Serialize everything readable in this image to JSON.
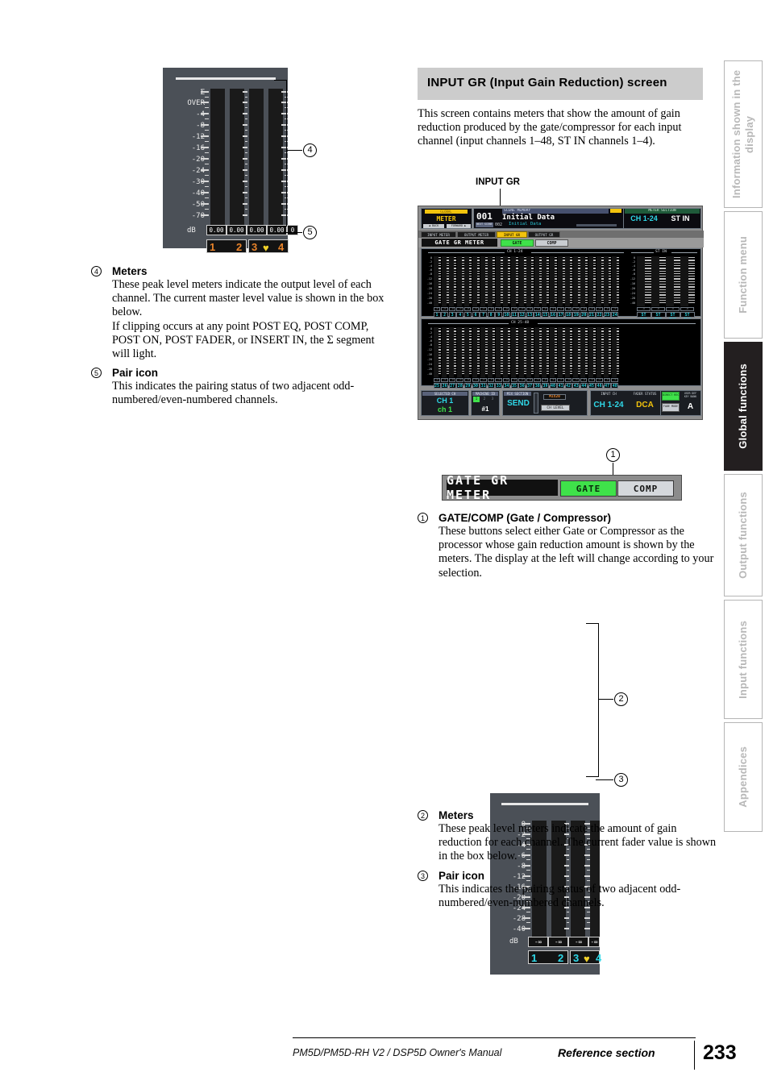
{
  "page": {
    "number": "233",
    "manual": "PM5D/PM5D-RH V2 / DSP5D Owner's Manual",
    "section": "Reference section"
  },
  "sidebar": {
    "tabs": [
      {
        "label": "Information shown in the display",
        "active": false
      },
      {
        "label": "Function menu",
        "active": false
      },
      {
        "label": "Global functions",
        "active": true
      },
      {
        "label": "Output functions",
        "active": false
      },
      {
        "label": "Input functions",
        "active": false
      },
      {
        "label": "Appendices",
        "active": false
      }
    ]
  },
  "left_column": {
    "figure": {
      "scale_labels": [
        "Σ",
        "OVER",
        "-4",
        "-8",
        "-12",
        "-16",
        "-20",
        "-24",
        "-30",
        "-40",
        "-50",
        "-70"
      ],
      "unit_label": "dB",
      "values": [
        "0.00",
        "0.00",
        "0.00",
        "0.00",
        "0"
      ],
      "pair_numbers": [
        "1",
        "2",
        "3",
        "4"
      ],
      "pair_heart": "♥",
      "callouts": [
        "4",
        "5"
      ]
    },
    "items": [
      {
        "number": "4",
        "title": "Meters",
        "paragraphs": [
          "These peak level meters indicate the output level of each channel. The current master level value is shown in the box below.",
          "If clipping occurs at any point POST EQ, POST COMP, POST ON, POST FADER, or INSERT IN, the Σ segment will light."
        ]
      },
      {
        "number": "5",
        "title": "Pair icon",
        "paragraphs": [
          "This indicates the pairing status of two adjacent odd-numbered/even-numbered channels."
        ]
      }
    ]
  },
  "right_column": {
    "heading": "INPUT GR (Input Gain Reduction) screen",
    "intro": "This screen contains meters that show the amount of gain reduction produced by the gate/compressor for each input channel (input channels 1–48, ST IN channels 1–4).",
    "screenshot_callout": "INPUT GR",
    "lcd": {
      "global_label": "GLOBAL",
      "menu_title": "METER",
      "nav_back": "◀ BACK",
      "nav_forward": "FORWARD ▶",
      "scene_memory_label": "SCENE MEMORY",
      "scene_number": "001",
      "scene_name": "Initial Data",
      "next_scene_label": "NEXT SCENE",
      "next_scene_number": "002",
      "next_scene_name": "Initial Data",
      "cascade_label": "CASCADE",
      "cascade_value": "SLAVE",
      "fs_label": "Fs",
      "fs_value": "48k",
      "meter_section_label": "METER SECTION",
      "meter_section_values": [
        "CH 1-24",
        "ST IN"
      ],
      "tabs": [
        {
          "label": "INPUT METER",
          "active": false
        },
        {
          "label": "OUTPUT METER",
          "active": false
        },
        {
          "label": "INPUT GR",
          "active": true
        },
        {
          "label": "OUTPUT GR",
          "active": false
        }
      ],
      "gate_gr_label": "GATE GR METER",
      "gate_button": "GATE",
      "comp_button": "COMP",
      "group_titles": [
        "CH 1-24",
        "ST IN",
        "CH 25-48"
      ],
      "scale": [
        "0",
        "-2",
        "-4",
        "-6",
        "-8",
        "-12",
        "-16",
        "-20",
        "-24",
        "-28",
        "-40"
      ],
      "channels_1_24": [
        "1",
        "2",
        "3",
        "4",
        "5",
        "6",
        "7",
        "8",
        "9",
        "10",
        "11",
        "12",
        "13",
        "14",
        "15",
        "16",
        "17",
        "18",
        "19",
        "20",
        "21",
        "22",
        "23",
        "24"
      ],
      "channels_25_48": [
        "25",
        "26",
        "27",
        "28",
        "29",
        "30",
        "31",
        "32",
        "33",
        "34",
        "35",
        "36",
        "37",
        "38",
        "39",
        "40",
        "41",
        "42",
        "43",
        "44",
        "45",
        "46",
        "47",
        "48"
      ],
      "channels_st_in": [
        "ST IN1",
        "ST IN2",
        "ST IN3",
        "ST IN4"
      ],
      "status": {
        "selected_ch_label": "SELECTED CH",
        "selected_ch_value": "CH 1",
        "selected_ch_name": "ch 1",
        "machine_id_label": "MACHINE ID",
        "machine_id_value": "#1",
        "machine_id_slots": [
          "1",
          "2",
          "3"
        ],
        "mix_section_label": "MIX SECTION",
        "send_button": "SEND",
        "mix_number": "MIX20",
        "ch_level_button": "CH LEVEL",
        "input_ch_label": "INPUT CH",
        "input_ch_value": "CH 1-24",
        "fader_status_label": "FADER STATUS",
        "fader_status_value": "DCA",
        "st_in_label": "ST IN / FX RTN",
        "st_in_value": "ST IN",
        "direct_recall_button": "DIRECT RECALL",
        "fade_mode_button": "FADE MODE",
        "user_def_label": "USER DEF KEY BANK",
        "user_def_value": "A"
      }
    },
    "gate_comp_detail": {
      "label": "GATE GR METER",
      "buttons": [
        "GATE",
        "COMP"
      ],
      "callout": "1"
    },
    "figure": {
      "scale_labels": [
        "0",
        "-2",
        "-4",
        "-6",
        "-8",
        "-12",
        "-16",
        "-20",
        "-24",
        "-28",
        "-40"
      ],
      "unit_label": "dB",
      "values": [
        "-∞",
        "-∞",
        "-∞",
        "-∞",
        "-"
      ],
      "pair_numbers": [
        "1",
        "2",
        "3",
        "4"
      ],
      "pair_heart": "♥",
      "callouts": [
        "2",
        "3"
      ]
    },
    "items": [
      {
        "number": "1",
        "title": "GATE/COMP (Gate / Compressor)",
        "paragraphs": [
          "These buttons select either Gate or Compressor as the processor whose gain reduction amount is shown by the meters. The display at the left will change according to your selection."
        ]
      },
      {
        "number": "2",
        "title": "Meters",
        "paragraphs": [
          "These peak level meters indicate the amount of gain reduction for each channel. The current fader value is shown in the box below."
        ]
      },
      {
        "number": "3",
        "title": "Pair icon",
        "paragraphs": [
          "This indicates the pairing status of two adjacent odd-numbered/even-numbered channels."
        ]
      }
    ]
  },
  "colors": {
    "heading_bg": "#cccccc",
    "figure_bg": "#4b5057",
    "lcd_bg": "#8f8f8f",
    "accent_cyan": "#2fd8e8",
    "accent_orange": "#e8832a",
    "accent_yellow": "#f2c30d",
    "accent_green": "#3fe24a",
    "sidebar_active": "#231f20"
  }
}
